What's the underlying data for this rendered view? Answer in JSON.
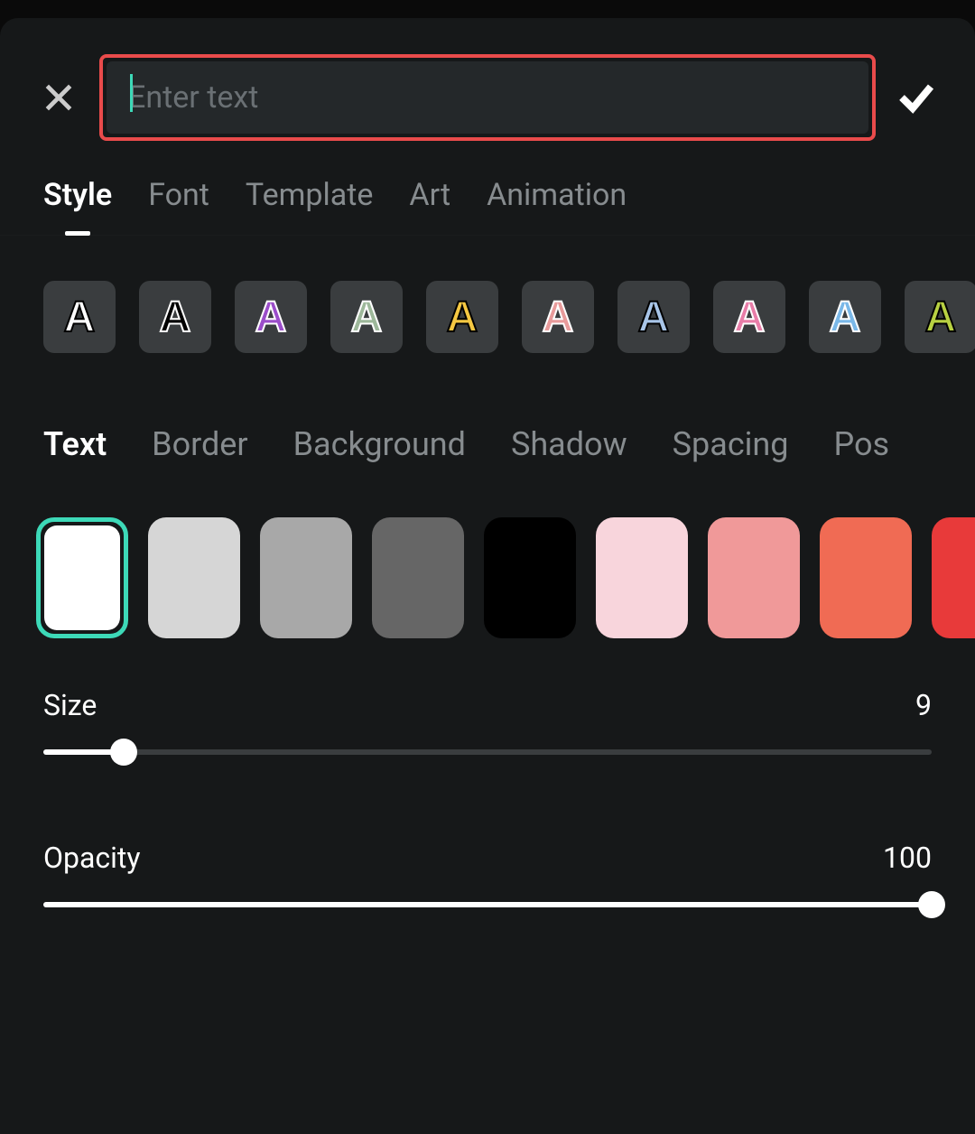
{
  "input": {
    "placeholder": "Enter text",
    "value": ""
  },
  "mainTabs": [
    {
      "label": "Style",
      "active": true
    },
    {
      "label": "Font",
      "active": false
    },
    {
      "label": "Template",
      "active": false
    },
    {
      "label": "Art",
      "active": false
    },
    {
      "label": "Animation",
      "active": false
    }
  ],
  "stylePresets": [
    {
      "fill": "#ffffff",
      "stroke": "#000000"
    },
    {
      "fill": "#000000",
      "stroke": "#ffffff"
    },
    {
      "fill": "#9b4dca",
      "stroke": "#ffffff"
    },
    {
      "fill": "#9db89a",
      "stroke": "#ffffff"
    },
    {
      "fill": "#f5c842",
      "stroke": "#000000"
    },
    {
      "fill": "#e89b9b",
      "stroke": "#ffffff"
    },
    {
      "fill": "#a8c5e8",
      "stroke": "#000000"
    },
    {
      "fill": "#e87da8",
      "stroke": "#ffffff"
    },
    {
      "fill": "#7ab8e8",
      "stroke": "#ffffff"
    },
    {
      "fill": "#b8d142",
      "stroke": "#000000"
    }
  ],
  "subTabs": [
    {
      "label": "Text",
      "active": true
    },
    {
      "label": "Border",
      "active": false
    },
    {
      "label": "Background",
      "active": false
    },
    {
      "label": "Shadow",
      "active": false
    },
    {
      "label": "Spacing",
      "active": false
    },
    {
      "label": "Pos",
      "active": false
    }
  ],
  "colorSwatches": [
    {
      "color": "#ffffff",
      "selected": true
    },
    {
      "color": "#d6d6d6",
      "selected": false
    },
    {
      "color": "#a8a8a8",
      "selected": false
    },
    {
      "color": "#666666",
      "selected": false
    },
    {
      "color": "#000000",
      "selected": false
    },
    {
      "color": "#f8d5dc",
      "selected": false
    },
    {
      "color": "#f09999",
      "selected": false
    },
    {
      "color": "#f06b54",
      "selected": false
    },
    {
      "color": "#e83a3a",
      "selected": false
    }
  ],
  "sliders": {
    "size": {
      "label": "Size",
      "value": 9,
      "min": 0,
      "max": 100
    },
    "opacity": {
      "label": "Opacity",
      "value": 100,
      "min": 0,
      "max": 100
    }
  }
}
